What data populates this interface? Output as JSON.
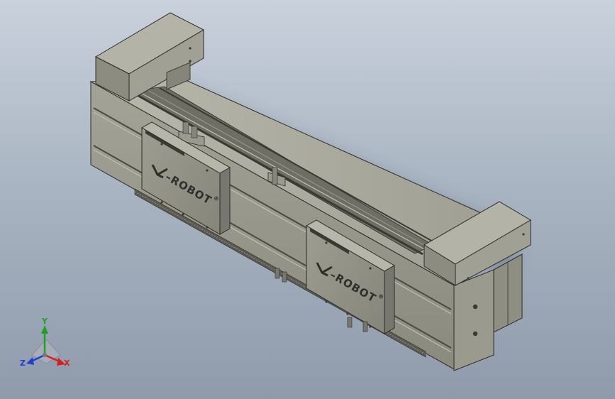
{
  "model": {
    "logo_1": "–ROBOT",
    "logo_2": "–ROBOT",
    "logo_mark": "®"
  },
  "triad": {
    "x_label": "X",
    "y_label": "Y",
    "z_label": "Z"
  },
  "colors": {
    "background_top": "#c9d1dc",
    "background_bottom": "#8f9aab",
    "body": "#8f8f84",
    "body_light": "#a8a89c",
    "body_dark": "#6f6f66",
    "x_axis": "#d42020",
    "y_axis": "#20a020",
    "z_axis": "#2040d0"
  }
}
